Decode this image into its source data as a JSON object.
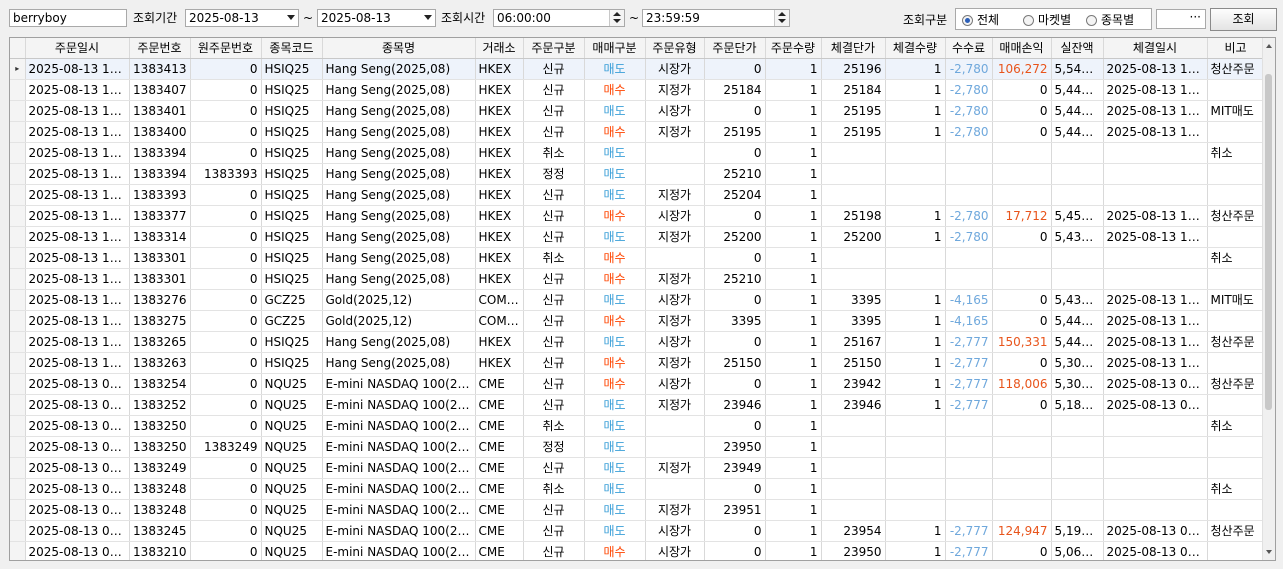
{
  "toolbar": {
    "account": "berryboy",
    "period_label": "조회기간",
    "date_from": "2025-08-13",
    "date_sep": "~",
    "date_to": "2025-08-13",
    "time_label": "조회시간",
    "time_from": "06:00:00",
    "time_sep": "~",
    "time_to": "23:59:59",
    "kind_label": "조회구분",
    "radio_all": "전체",
    "radio_market": "마켓별",
    "radio_item": "종목별",
    "more_button": "···",
    "search_button": "조회"
  },
  "colors": {
    "sell": "#3a9fd8",
    "buy": "#ff4500",
    "profit": "#e8541b",
    "fee": "#6fa8dc"
  },
  "columns": [
    "주문일시",
    "주문번호",
    "원주문번호",
    "종목코드",
    "종목명",
    "거래소",
    "주문구분",
    "매매구분",
    "주문유형",
    "주문단가",
    "주문수량",
    "체결단가",
    "체결수량",
    "수수료",
    "매매손익",
    "실잔액",
    "체결일시",
    "비고"
  ],
  "rows": [
    [
      "2025-08-13 10:…",
      "1383413",
      "0",
      "HSIQ25",
      "Hang Seng(2025,08)",
      "HKEX",
      "신규",
      "매도",
      "시장가",
      "0",
      "1",
      "25196",
      "1",
      "-2,780",
      "106,272",
      "5,547,…",
      "2025-08-13 10:…",
      "청산주문"
    ],
    [
      "2025-08-13 10:…",
      "1383407",
      "0",
      "HSIQ25",
      "Hang Seng(2025,08)",
      "HKEX",
      "신규",
      "매수",
      "지정가",
      "25184",
      "1",
      "25184",
      "1",
      "-2,780",
      "0",
      "5,443,…",
      "2025-08-13 10:…",
      ""
    ],
    [
      "2025-08-13 10:…",
      "1383401",
      "0",
      "HSIQ25",
      "Hang Seng(2025,08)",
      "HKEX",
      "신규",
      "매도",
      "시장가",
      "0",
      "1",
      "25195",
      "1",
      "-2,780",
      "0",
      "5,446,…",
      "2025-08-13 10:…",
      "MIT매도"
    ],
    [
      "2025-08-13 10:…",
      "1383400",
      "0",
      "HSIQ25",
      "Hang Seng(2025,08)",
      "HKEX",
      "신규",
      "매수",
      "지정가",
      "25195",
      "1",
      "25195",
      "1",
      "-2,780",
      "0",
      "5,449,…",
      "2025-08-13 10:…",
      ""
    ],
    [
      "2025-08-13 10:…",
      "1383394",
      "0",
      "HSIQ25",
      "Hang Seng(2025,08)",
      "HKEX",
      "취소",
      "매도",
      "",
      "0",
      "1",
      "",
      "",
      "",
      "",
      "",
      "",
      "취소"
    ],
    [
      "2025-08-13 10:…",
      "1383394",
      "1383393",
      "HSIQ25",
      "Hang Seng(2025,08)",
      "HKEX",
      "정정",
      "매도",
      "",
      "25210",
      "1",
      "",
      "",
      "",
      "",
      "",
      "",
      ""
    ],
    [
      "2025-08-13 10:…",
      "1383393",
      "0",
      "HSIQ25",
      "Hang Seng(2025,08)",
      "HKEX",
      "신규",
      "매도",
      "지정가",
      "25204",
      "1",
      "",
      "",
      "",
      "",
      "",
      "",
      ""
    ],
    [
      "2025-08-13 10:…",
      "1383377",
      "0",
      "HSIQ25",
      "Hang Seng(2025,08)",
      "HKEX",
      "신규",
      "매수",
      "시장가",
      "0",
      "1",
      "25198",
      "1",
      "-2,780",
      "17,712",
      "5,451,…",
      "2025-08-13 10:…",
      "청산주문"
    ],
    [
      "2025-08-13 10:…",
      "1383314",
      "0",
      "HSIQ25",
      "Hang Seng(2025,08)",
      "HKEX",
      "신규",
      "매도",
      "지정가",
      "25200",
      "1",
      "25200",
      "1",
      "-2,780",
      "0",
      "5,436,…",
      "2025-08-13 10:…",
      ""
    ],
    [
      "2025-08-13 10:…",
      "1383301",
      "0",
      "HSIQ25",
      "Hang Seng(2025,08)",
      "HKEX",
      "취소",
      "매수",
      "",
      "0",
      "1",
      "",
      "",
      "",
      "",
      "",
      "",
      "취소"
    ],
    [
      "2025-08-13 10:…",
      "1383301",
      "0",
      "HSIQ25",
      "Hang Seng(2025,08)",
      "HKEX",
      "신규",
      "매수",
      "지정가",
      "25210",
      "1",
      "",
      "",
      "",
      "",
      "",
      "",
      ""
    ],
    [
      "2025-08-13 10:…",
      "1383276",
      "0",
      "GCZ25",
      "Gold(2025,12)",
      "COM…",
      "신규",
      "매도",
      "시장가",
      "0",
      "1",
      "3395",
      "1",
      "-4,165",
      "0",
      "5,439,…",
      "2025-08-13 10:…",
      "MIT매도"
    ],
    [
      "2025-08-13 10:…",
      "1383275",
      "0",
      "GCZ25",
      "Gold(2025,12)",
      "COM…",
      "신규",
      "매수",
      "지정가",
      "3395",
      "1",
      "3395",
      "1",
      "-4,165",
      "0",
      "5,443,…",
      "2025-08-13 10:…",
      ""
    ],
    [
      "2025-08-13 10:…",
      "1383265",
      "0",
      "HSIQ25",
      "Hang Seng(2025,08)",
      "HKEX",
      "신규",
      "매도",
      "시장가",
      "0",
      "1",
      "25167",
      "1",
      "-2,777",
      "150,331",
      "5,448,…",
      "2025-08-13 10:…",
      "청산주문"
    ],
    [
      "2025-08-13 10:…",
      "1383263",
      "0",
      "HSIQ25",
      "Hang Seng(2025,08)",
      "HKEX",
      "신규",
      "매수",
      "지정가",
      "25150",
      "1",
      "25150",
      "1",
      "-2,777",
      "0",
      "5,300,…",
      "2025-08-13 10:…",
      ""
    ],
    [
      "2025-08-13 09:…",
      "1383254",
      "0",
      "NQU25",
      "E-mini NASDAQ 100(20…",
      "CME",
      "신규",
      "매수",
      "시장가",
      "0",
      "1",
      "23942",
      "1",
      "-2,777",
      "118,006",
      "5,303,…",
      "2025-08-13 09:…",
      "청산주문"
    ],
    [
      "2025-08-13 09:…",
      "1383252",
      "0",
      "NQU25",
      "E-mini NASDAQ 100(20…",
      "CME",
      "신규",
      "매도",
      "지정가",
      "23946",
      "1",
      "23946",
      "1",
      "-2,777",
      "0",
      "5,188,…",
      "2025-08-13 09:…",
      ""
    ],
    [
      "2025-08-13 09:…",
      "1383250",
      "0",
      "NQU25",
      "E-mini NASDAQ 100(20…",
      "CME",
      "취소",
      "매도",
      "",
      "0",
      "1",
      "",
      "",
      "",
      "",
      "",
      "",
      "취소"
    ],
    [
      "2025-08-13 09:…",
      "1383250",
      "1383249",
      "NQU25",
      "E-mini NASDAQ 100(20…",
      "CME",
      "정정",
      "매도",
      "",
      "23950",
      "1",
      "",
      "",
      "",
      "",
      "",
      "",
      ""
    ],
    [
      "2025-08-13 09:…",
      "1383249",
      "0",
      "NQU25",
      "E-mini NASDAQ 100(20…",
      "CME",
      "신규",
      "매도",
      "지정가",
      "23949",
      "1",
      "",
      "",
      "",
      "",
      "",
      "",
      ""
    ],
    [
      "2025-08-13 09:…",
      "1383248",
      "0",
      "NQU25",
      "E-mini NASDAQ 100(20…",
      "CME",
      "취소",
      "매도",
      "",
      "0",
      "1",
      "",
      "",
      "",
      "",
      "",
      "",
      "취소"
    ],
    [
      "2025-08-13 09:…",
      "1383248",
      "0",
      "NQU25",
      "E-mini NASDAQ 100(20…",
      "CME",
      "신규",
      "매도",
      "지정가",
      "23951",
      "1",
      "",
      "",
      "",
      "",
      "",
      "",
      ""
    ],
    [
      "2025-08-13 09:…",
      "1383245",
      "0",
      "NQU25",
      "E-mini NASDAQ 100(20…",
      "CME",
      "신규",
      "매도",
      "시장가",
      "0",
      "1",
      "23954",
      "1",
      "-2,777",
      "124,947",
      "5,190,…",
      "2025-08-13 09:…",
      "청산주문"
    ],
    [
      "2025-08-13 09:…",
      "1383210",
      "0",
      "NQU25",
      "E-mini NASDAQ 100(20…",
      "CME",
      "신규",
      "매수",
      "시장가",
      "0",
      "1",
      "23950",
      "1",
      "-2,777",
      "0",
      "5,068,…",
      "2025-08-13 09:…",
      ""
    ]
  ],
  "selected_row": 0,
  "row_indicator_icon": "right-triangle-icon"
}
